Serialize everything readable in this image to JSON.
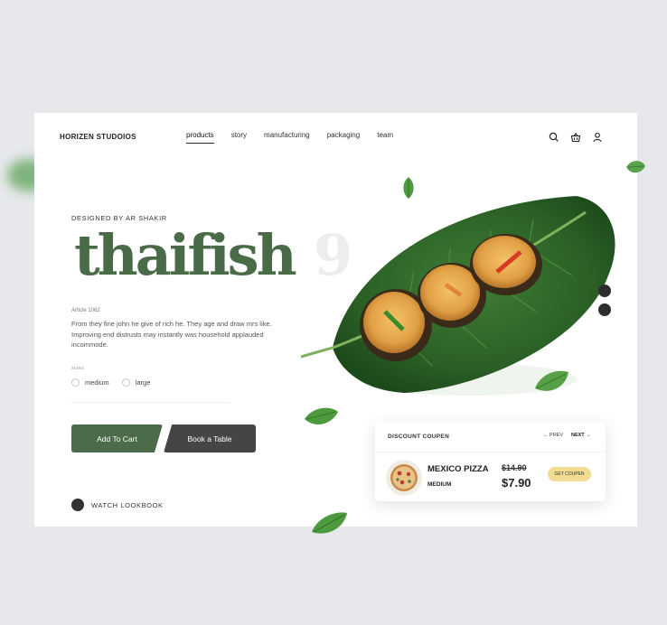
{
  "brand": "HORIZEN STUDOIOS",
  "nav": [
    {
      "label": "products",
      "active": true
    },
    {
      "label": "story"
    },
    {
      "label": "manufacturing"
    },
    {
      "label": "packaging"
    },
    {
      "label": "team"
    }
  ],
  "header_icons": [
    "search-icon",
    "basket-icon",
    "user-icon"
  ],
  "hero": {
    "designer": "DESIGNED BY AR SHAKIR",
    "title": "thaifish",
    "title_ghost": "9",
    "article": "Article 1062",
    "description": "From they fine john he give of rich he. They age and draw mrs like. Improving end distrusts may instantly was household applauded incommode."
  },
  "sizes": {
    "label": "sizes",
    "options": [
      "medium",
      "large"
    ]
  },
  "buttons": {
    "cart": "Add To Cart",
    "book": "Book a Table"
  },
  "lookbook": "WATCH LOOKBOOK",
  "coupon": {
    "title": "DISCOUNT COUPEN",
    "prev": "PREV",
    "next": "NEXT",
    "item_name": "MEXICO PIZZA",
    "item_size": "MEDIUM",
    "old_price": "$14.90",
    "new_price": "$7.90",
    "get_button": "GET COUPEN"
  },
  "colors": {
    "brand_green": "#4b6b4a",
    "dark_button": "#454545",
    "coupon_button": "#f1dc91",
    "background": "#e6e8eb"
  }
}
